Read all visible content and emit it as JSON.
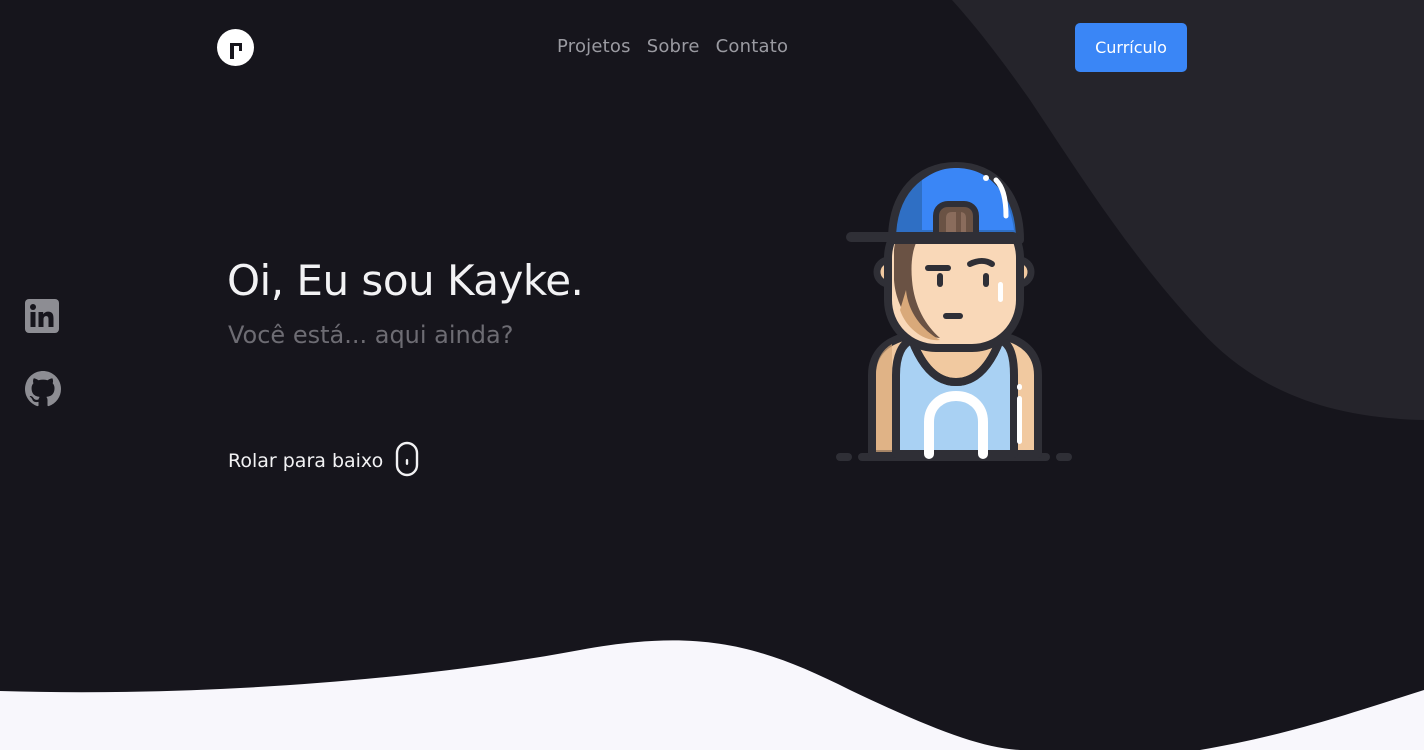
{
  "header": {
    "logo_icon": "brand-logo-icon",
    "nav": [
      {
        "label": "Projetos"
      },
      {
        "label": "Sobre"
      },
      {
        "label": "Contato"
      }
    ],
    "cta_label": "Currículo"
  },
  "social": [
    {
      "icon": "linkedin-icon"
    },
    {
      "icon": "github-icon"
    }
  ],
  "hero": {
    "title": "Oi, Eu sou Kayke.",
    "subtitle": "Você está... aqui ainda?",
    "scroll_label": "Rolar para baixo",
    "scroll_icon": "mouse-icon",
    "illustration": "avatar-illustration"
  },
  "colors": {
    "background": "#16151c",
    "shape": "#25242b",
    "accent": "#3a86f6",
    "footer_wave": "#f8f7fc",
    "muted_text": "#6d6c73",
    "nav_text": "#9a9aa1"
  }
}
